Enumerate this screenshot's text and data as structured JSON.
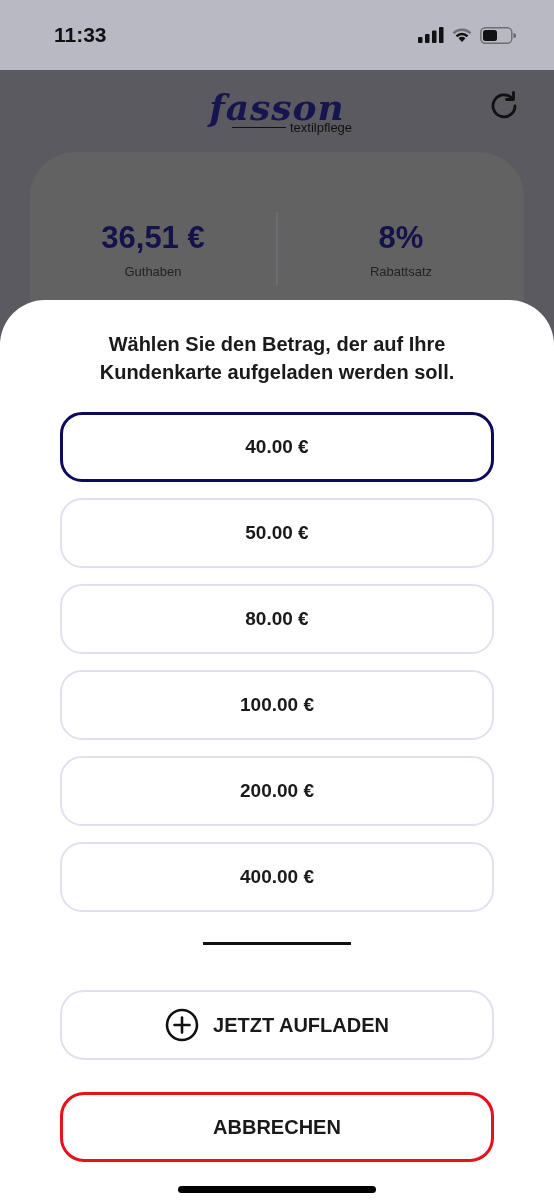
{
  "status_bar": {
    "time": "11:33"
  },
  "header": {
    "logo": {
      "brand": "fasson",
      "subtitle": "textilpflege"
    }
  },
  "summary": [
    {
      "value": "36,51 €",
      "label": "Guthaben"
    },
    {
      "value": "8%",
      "label": "Rabattsatz"
    }
  ],
  "sheet": {
    "title": "Wählen Sie den Betrag, der auf Ihre Kundenkarte aufgeladen werden soll.",
    "amounts": [
      {
        "label": "40.00 €",
        "selected": true
      },
      {
        "label": "50.00 €",
        "selected": false
      },
      {
        "label": "80.00 €",
        "selected": false
      },
      {
        "label": "100.00 €",
        "selected": false
      },
      {
        "label": "200.00 €",
        "selected": false
      },
      {
        "label": "400.00 €",
        "selected": false
      }
    ],
    "actions": [
      {
        "kind": "primary",
        "label": "JETZT AUFLADEN"
      },
      {
        "kind": "cancel",
        "label": "ABBRECHEN"
      }
    ]
  }
}
